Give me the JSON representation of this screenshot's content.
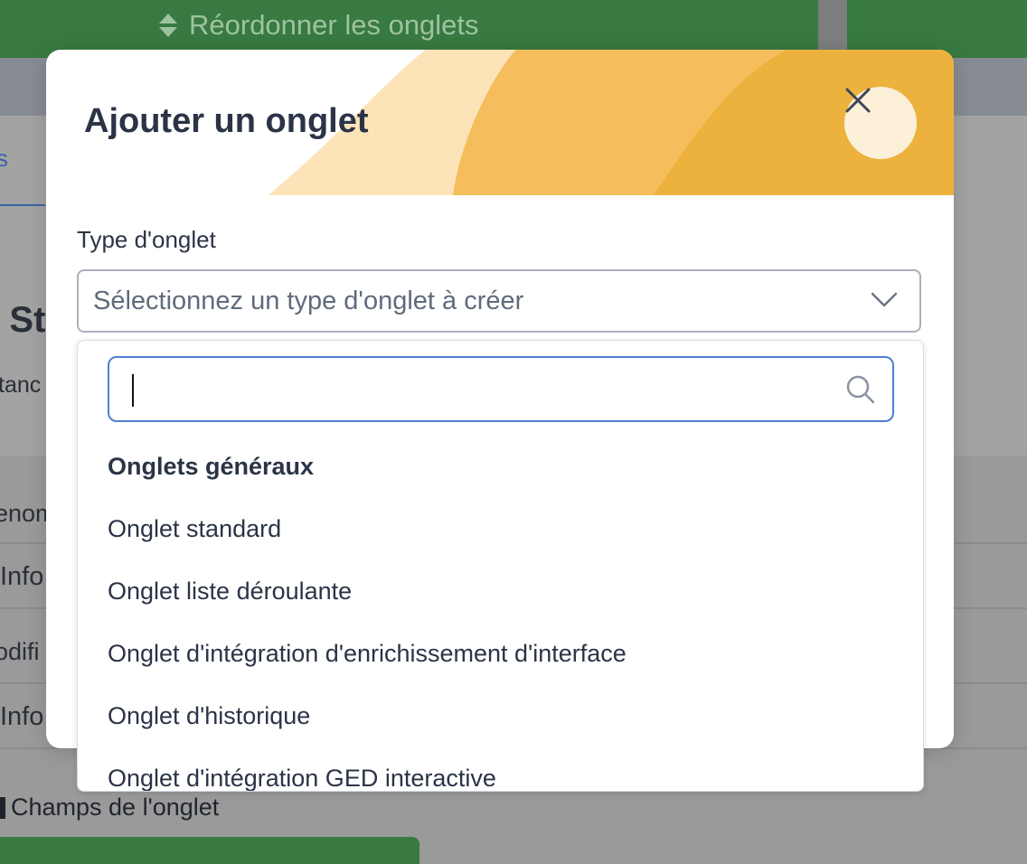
{
  "background": {
    "reorder_label": "Réordonner les onglets",
    "tab_fragment": "s",
    "title_fragment": "t St",
    "subtitle_fragment": "tanc",
    "rows": [
      "enom",
      "Info",
      "odifi",
      "Info"
    ],
    "champs_label": "Champs de l'onglet"
  },
  "modal": {
    "title": "Ajouter un onglet",
    "close_icon": "close-icon",
    "header_colors": [
      "#fde3b8",
      "#f5bd5c",
      "#ecb23d"
    ],
    "field_label": "Type d'onglet",
    "select_placeholder": "Sélectionnez un type d'onglet à créer",
    "dropdown": {
      "search_value": "",
      "search_icon": "search-icon",
      "group_label": "Onglets généraux",
      "options": [
        "Onglet standard",
        "Onglet liste déroulante",
        "Onglet d'intégration d'enrichissement d'interface",
        "Onglet d'historique",
        "Onglet d'intégration GED interactive"
      ]
    }
  }
}
